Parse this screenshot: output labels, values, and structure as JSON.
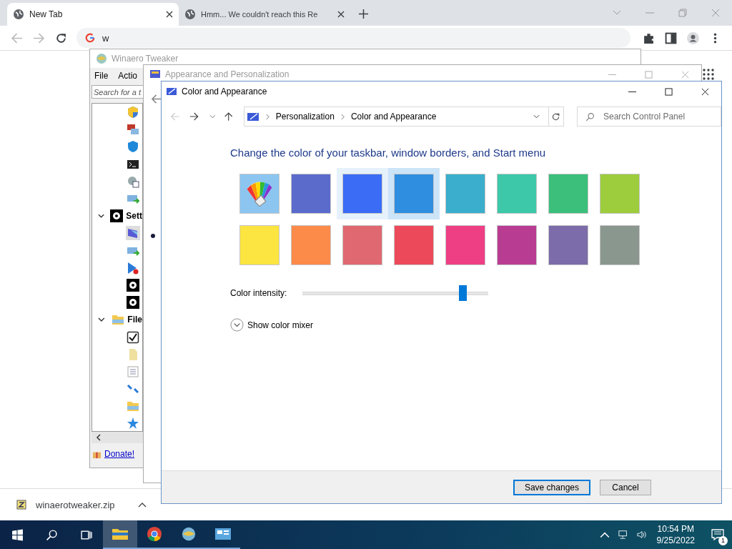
{
  "browser": {
    "tabs": [
      {
        "title": "New Tab",
        "selected": true
      },
      {
        "title": "Hmm... We couldn't reach this Re",
        "selected": false
      }
    ],
    "address": "w",
    "download": {
      "file": "winaerotweaker.zip"
    }
  },
  "winaero": {
    "title": "Winaero Tweaker",
    "active": false,
    "menu": [
      "File",
      "Actio"
    ],
    "search": {
      "placeholder": "Search for a t"
    },
    "tree": [
      {
        "kind": "shield"
      },
      {
        "kind": "remote"
      },
      {
        "kind": "defender"
      },
      {
        "kind": "terminal"
      },
      {
        "kind": "gear-check"
      },
      {
        "kind": "network"
      },
      {
        "label": "Sett",
        "kind": "gear",
        "expanded": true,
        "children": [
          {
            "kind": "monitor",
            "selected": true
          },
          {
            "kind": "network",
            "selected": false
          },
          {
            "kind": "play-x",
            "selected": false
          },
          {
            "kind": "gear",
            "selected": false
          },
          {
            "kind": "gear",
            "selected": false
          }
        ]
      },
      {
        "label": "File",
        "kind": "folder",
        "expanded": true,
        "children": [
          {
            "kind": "check",
            "selected": false
          },
          {
            "kind": "doc",
            "selected": false
          },
          {
            "kind": "list",
            "selected": false
          },
          {
            "kind": "arrows",
            "selected": false
          },
          {
            "kind": "folder",
            "selected": false
          },
          {
            "kind": "star",
            "selected": false
          }
        ]
      }
    ],
    "donate": "Donate!"
  },
  "appearance_window": {
    "title": "Appearance and Personalization",
    "active": false
  },
  "color_window": {
    "title": "Color and Appearance",
    "active": true,
    "breadcrumb": [
      "Personalization",
      "Color and Appearance"
    ],
    "search": {
      "placeholder": "Search Control Panel"
    },
    "heading": "Change the color of your taskbar, window borders, and Start menu",
    "swatches": [
      {
        "kind": "auto",
        "selected": false,
        "hovered": false
      },
      {
        "kind": "color",
        "color": "#5b6bcc",
        "selected": false,
        "hovered": false
      },
      {
        "kind": "color",
        "color": "#3a6cf5",
        "selected": false,
        "hovered": true
      },
      {
        "kind": "color",
        "color": "#2f8ee0",
        "selected": true,
        "hovered": false
      },
      {
        "kind": "color",
        "color": "#3aaecc",
        "selected": false,
        "hovered": false
      },
      {
        "kind": "color",
        "color": "#3cc8a9",
        "selected": false,
        "hovered": false
      },
      {
        "kind": "color",
        "color": "#3bbf7b",
        "selected": false,
        "hovered": false
      },
      {
        "kind": "color",
        "color": "#9dcd3d",
        "selected": false,
        "hovered": false
      },
      {
        "kind": "color",
        "color": "#fce541",
        "selected": false,
        "hovered": false
      },
      {
        "kind": "color",
        "color": "#fc8a49",
        "selected": false,
        "hovered": false
      },
      {
        "kind": "color",
        "color": "#e06871",
        "selected": false,
        "hovered": false
      },
      {
        "kind": "color",
        "color": "#ec4a5a",
        "selected": false,
        "hovered": false
      },
      {
        "kind": "color",
        "color": "#ee3f85",
        "selected": false,
        "hovered": false
      },
      {
        "kind": "color",
        "color": "#b93c93",
        "selected": false,
        "hovered": false
      },
      {
        "kind": "color",
        "color": "#7c6ca9",
        "selected": false,
        "hovered": false
      },
      {
        "kind": "color",
        "color": "#8a978f",
        "selected": false,
        "hovered": false
      }
    ],
    "intensity": {
      "label": "Color intensity:",
      "level": 0.86
    },
    "mixer": {
      "label": "Show color mixer",
      "expanded": false
    },
    "buttons": [
      {
        "label": "Save changes",
        "default": true
      },
      {
        "label": "Cancel",
        "default": false
      }
    ]
  },
  "taskbar": {
    "apps": [
      {
        "kind": "explorer",
        "active": true
      },
      {
        "kind": "chrome",
        "active": false
      },
      {
        "kind": "winaero",
        "active": false
      },
      {
        "kind": "control-panel",
        "active": false
      }
    ],
    "time": "10:54 PM",
    "date": "9/25/2022",
    "notifications": "1"
  }
}
